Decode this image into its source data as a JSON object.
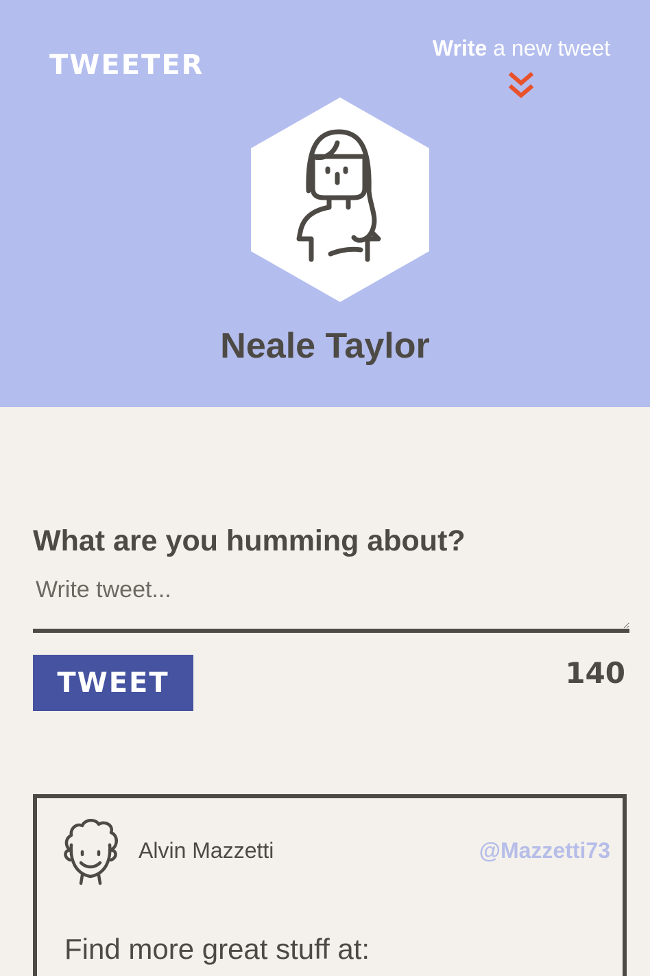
{
  "header": {
    "brand": "TWEETER",
    "write_link": {
      "strong": "Write",
      "rest": " a new tweet"
    },
    "accent_color": "#e8512a",
    "background_color": "#b3bdee",
    "avatar_icon": "female-avatar-icon",
    "user_name": "Neale Taylor"
  },
  "compose": {
    "title": "What are you humming about?",
    "placeholder": "Write tweet...",
    "button_label": "TWEET",
    "button_color": "#4553a0",
    "char_count": "140"
  },
  "tweets": [
    {
      "avatar_icon": "male-avatar-icon",
      "name": "Alvin Mazzetti",
      "handle": "@Mazzetti73",
      "text": "Find more great stuff at:"
    }
  ]
}
